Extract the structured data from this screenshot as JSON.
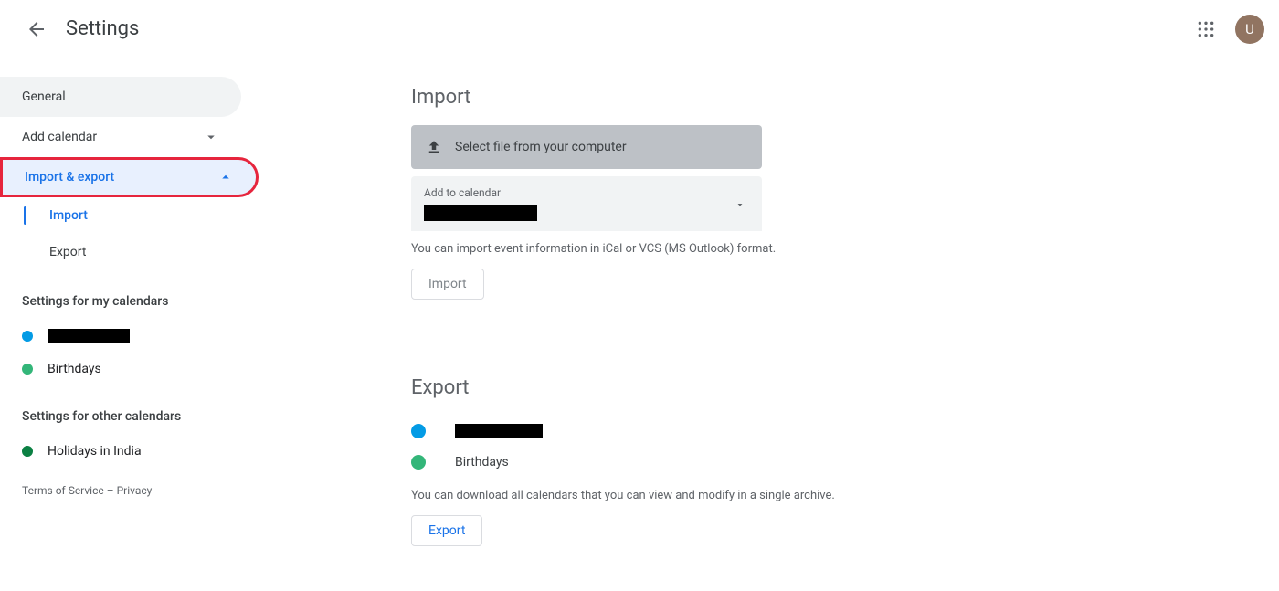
{
  "header": {
    "title": "Settings",
    "avatar_letter": "U"
  },
  "sidebar": {
    "general": "General",
    "add_calendar": "Add calendar",
    "import_export": "Import & export",
    "sub": {
      "import": "Import",
      "export": "Export"
    },
    "heading_my": "Settings for my calendars",
    "my_calendars": [
      {
        "label_redacted": true,
        "color": "#039be5"
      },
      {
        "label": "Birthdays",
        "color": "#33b679"
      }
    ],
    "heading_other": "Settings for other calendars",
    "other_calendars": [
      {
        "label": "Holidays in India",
        "color": "#0b8043"
      }
    ]
  },
  "footer": {
    "terms": "Terms of Service",
    "separator": " – ",
    "privacy": "Privacy"
  },
  "import": {
    "title": "Import",
    "file_button": "Select file from your computer",
    "dropdown_label": "Add to calendar",
    "hint": "You can import event information in iCal or VCS (MS Outlook) format.",
    "button": "Import"
  },
  "export": {
    "title": "Export",
    "calendars": [
      {
        "label_redacted": true,
        "color": "#039be5"
      },
      {
        "label": "Birthdays",
        "color": "#33b679"
      }
    ],
    "hint": "You can download all calendars that you can view and modify in a single archive.",
    "button": "Export"
  }
}
